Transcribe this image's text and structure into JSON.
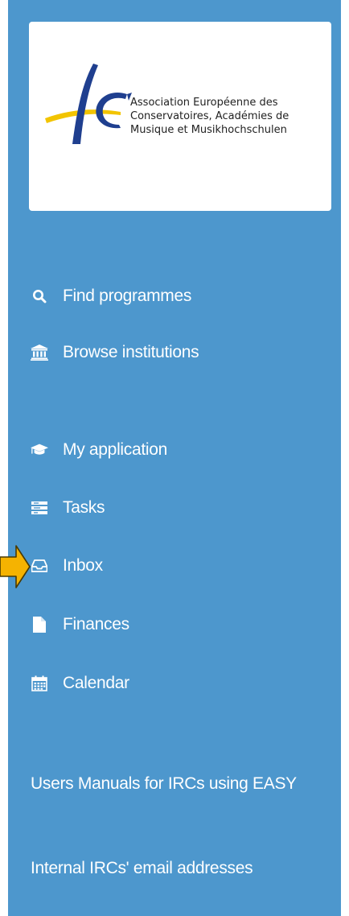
{
  "logo": {
    "line1": "Association Européenne des",
    "line2": "Conservatoires, Académies de",
    "line3": "Musique et Musikhochschulen"
  },
  "nav": {
    "find_programmes": "Find programmes",
    "browse_institutions": "Browse institutions",
    "my_application": "My application",
    "tasks": "Tasks",
    "inbox": "Inbox",
    "finances": "Finances",
    "calendar": "Calendar"
  },
  "links": {
    "users_manuals": "Users Manuals for IRCs using EASY",
    "internal_emails": "Internal IRCs' email addresses"
  },
  "colors": {
    "sidebar_bg": "#4d97cd",
    "text": "#ffffff",
    "pointer": "#f5b301"
  }
}
